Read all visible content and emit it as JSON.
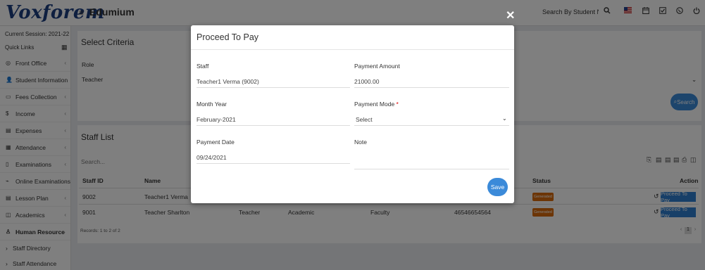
{
  "header": {
    "logo": "Voxforem",
    "app_name": "Edumium",
    "search_student": "Search By Student Name",
    "icons": [
      "menu-icon",
      "search-icon",
      "flag-icon",
      "calendar-icon",
      "task-icon",
      "whatsapp-icon",
      "power-icon"
    ]
  },
  "sidebar": {
    "session": "Current Session: 2021-22",
    "quick_links": "Quick Links",
    "items": [
      {
        "label": "Front Office",
        "icon": "◎"
      },
      {
        "label": "Student Information",
        "icon": "👤"
      },
      {
        "label": "Fees Collection",
        "icon": "▭"
      },
      {
        "label": "Income",
        "icon": "$"
      },
      {
        "label": "Expenses",
        "icon": "▤"
      },
      {
        "label": "Attendance",
        "icon": "▦"
      },
      {
        "label": "Examinations",
        "icon": "▯"
      },
      {
        "label": "Online Examinations",
        "icon": "⌁"
      },
      {
        "label": "Lesson Plan",
        "icon": "▤"
      },
      {
        "label": "Academics",
        "icon": "◫"
      },
      {
        "label": "Human Resource",
        "icon": "♙"
      }
    ],
    "sub_items": [
      "Staff Directory",
      "Staff Attendance"
    ]
  },
  "criteria": {
    "title": "Select Criteria",
    "role_label": "Role",
    "role_value": "Teacher",
    "search_button": "Search"
  },
  "staff_list": {
    "title": "Staff List",
    "search_placeholder": "Search...",
    "columns": [
      "Staff ID",
      "Name",
      "Status",
      "Action"
    ],
    "rows": [
      {
        "id": "9002",
        "name": "Teacher1 Verma",
        "role": "",
        "department": "",
        "designation": "",
        "phone": "",
        "status": "Generated",
        "action": "Proceed To Pay"
      },
      {
        "id": "9001",
        "name": "Teacher Sharlton",
        "role": "Teacher",
        "department": "Academic",
        "designation": "Faculty",
        "phone": "46546654564",
        "status": "Generated",
        "action": "Proceed To Pay"
      }
    ],
    "records": "Records: 1 to 2 of 2",
    "page": "1"
  },
  "modal": {
    "title": "Proceed To Pay",
    "staff_label": "Staff",
    "staff_value": "Teacher1 Verma (9002)",
    "amount_label": "Payment Amount",
    "amount_value": "21000.00",
    "month_label": "Month Year",
    "month_value": "February-2021",
    "mode_label": "Payment Mode",
    "mode_value": "Select",
    "date_label": "Payment Date",
    "date_value": "09/24/2021",
    "note_label": "Note",
    "save_button": "Save"
  }
}
